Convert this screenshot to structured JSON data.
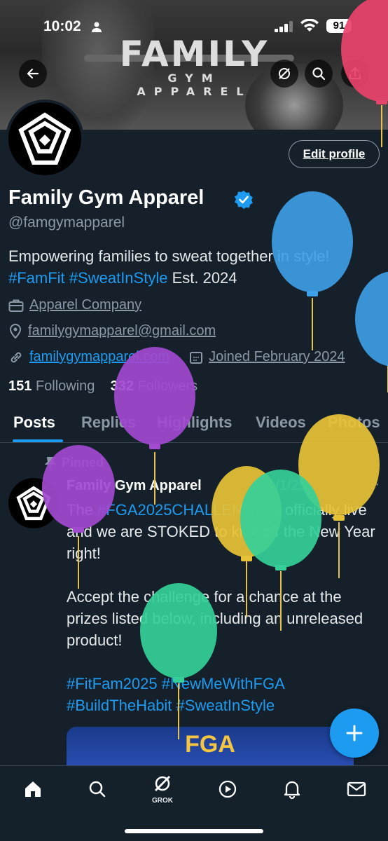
{
  "status_bar": {
    "time": "10:02",
    "battery": "91"
  },
  "banner": {
    "brand_big": "FAMILY",
    "brand_small": "GYM APPAREL"
  },
  "profile": {
    "edit_label": "Edit profile",
    "name": "Family Gym Apparel",
    "handle": "@famgymapparel",
    "bio_text_1": "Empowering families to sweat together in style!",
    "bio_tag_1": "#FamFit",
    "bio_tag_2": "#SweatInStyle",
    "bio_text_2": "Est. 2024",
    "category": "Apparel Company",
    "email": "familygymapparel@gmail.com",
    "website": "familygymapparel.com",
    "joined": "Joined February 2024",
    "following_count": "151",
    "following_label": "Following",
    "followers_count": "332",
    "followers_label": "Followers"
  },
  "tabs": [
    "Posts",
    "Replies",
    "Highlights",
    "Videos",
    "Photos"
  ],
  "post": {
    "pinned_label": "Pinned",
    "author": "Family Gym Apparel",
    "date": "1/1/25",
    "line1_pre": "The ",
    "line1_tag": "#FGA2025CHALLENGE",
    "line1_post": " is officially live and we are STOKED to kick off the New Year right!",
    "para2": "Accept the challenge for a chance at the prizes listed below, including an unreleased product!",
    "tags_line1": "#FitFam2025 #NewMeWithFGA",
    "tags_line2": "#BuildTheHabit #SweatInStyle",
    "image_text": "FGA"
  },
  "tabbar": {
    "grok_label": "GROK"
  },
  "colors": {
    "accent": "#1d9bf0",
    "background": "#15202b",
    "muted": "#8b98a5"
  }
}
